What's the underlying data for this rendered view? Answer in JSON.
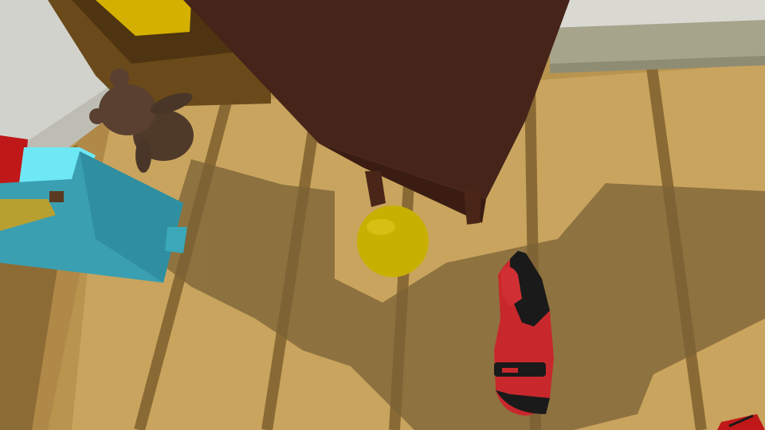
{
  "scene": {
    "type": "first-person VR room view (looking down at floor)",
    "colors": {
      "floor_light": "#c9a45e",
      "floor_mid": "#a8884a",
      "floor_plank_line": "#8a6a34",
      "shadow": "#7a6236",
      "wall": "#d9d9d2",
      "wall_trim": "#a7a48c",
      "shelf_dark": "#46241a",
      "door_frame": "#6a4a1a",
      "yellow_panel": "#d4b000",
      "ball_yellow": "#c8b000",
      "teddy_brown": "#5a4030",
      "crate_cyan": "#3a9fb0",
      "crate_cyan_light": "#6fe8f5",
      "crate_red": "#c01818",
      "glove_red": "#c8282c",
      "glove_black": "#1a1a1a"
    },
    "objects": [
      {
        "name": "wooden-shelf",
        "label": ""
      },
      {
        "name": "yellow-ball",
        "label": ""
      },
      {
        "name": "teddy-bear",
        "label": ""
      },
      {
        "name": "blue-drawer-box",
        "label": ""
      },
      {
        "name": "player-right-glove-hand",
        "label": ""
      }
    ]
  }
}
